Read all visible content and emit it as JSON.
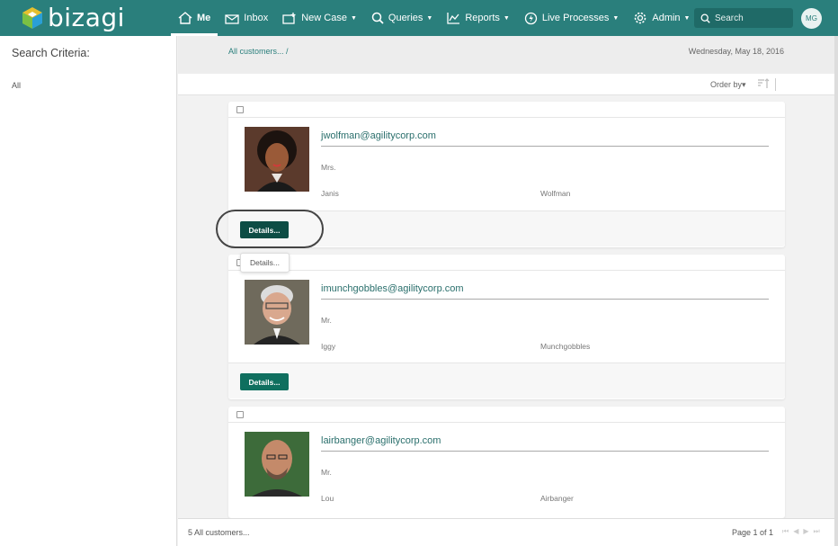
{
  "app": {
    "logo_text": "bizagi"
  },
  "nav": {
    "items": [
      {
        "label": "Me",
        "icon": "home-icon"
      },
      {
        "label": "Inbox",
        "icon": "inbox-icon"
      },
      {
        "label": "New Case",
        "icon": "new-case-icon"
      },
      {
        "label": "Queries",
        "icon": "search-icon"
      },
      {
        "label": "Reports",
        "icon": "chart-icon"
      },
      {
        "label": "Live Processes",
        "icon": "lightning-icon"
      },
      {
        "label": "Admin",
        "icon": "gear-icon"
      }
    ],
    "search_placeholder": "Search",
    "user_initials": "MG"
  },
  "sidebar": {
    "title": "Search Criteria:",
    "all_label": "All"
  },
  "header": {
    "breadcrumb": "All customers... /",
    "date": "Wednesday, May 18, 2016",
    "order_by": "Order by▾"
  },
  "cards": [
    {
      "email": "jwolfman@agilitycorp.com",
      "title": "Mrs.",
      "first": "Janis",
      "last": "Wolfman",
      "button": "Details..."
    },
    {
      "email": "imunchgobbles@agilitycorp.com",
      "title": "Mr.",
      "first": "Iggy",
      "last": "Munchgobbles",
      "button": "Details..."
    },
    {
      "email": "lairbanger@agilitycorp.com",
      "title": "Mr.",
      "first": "Lou",
      "last": "Airbanger"
    }
  ],
  "tooltip": "Details...",
  "footer": {
    "count": "5 All customers...",
    "page": "Page 1 of 1"
  },
  "colors": {
    "topbar": "#2a7f7c",
    "button": "#0f6f5f"
  }
}
